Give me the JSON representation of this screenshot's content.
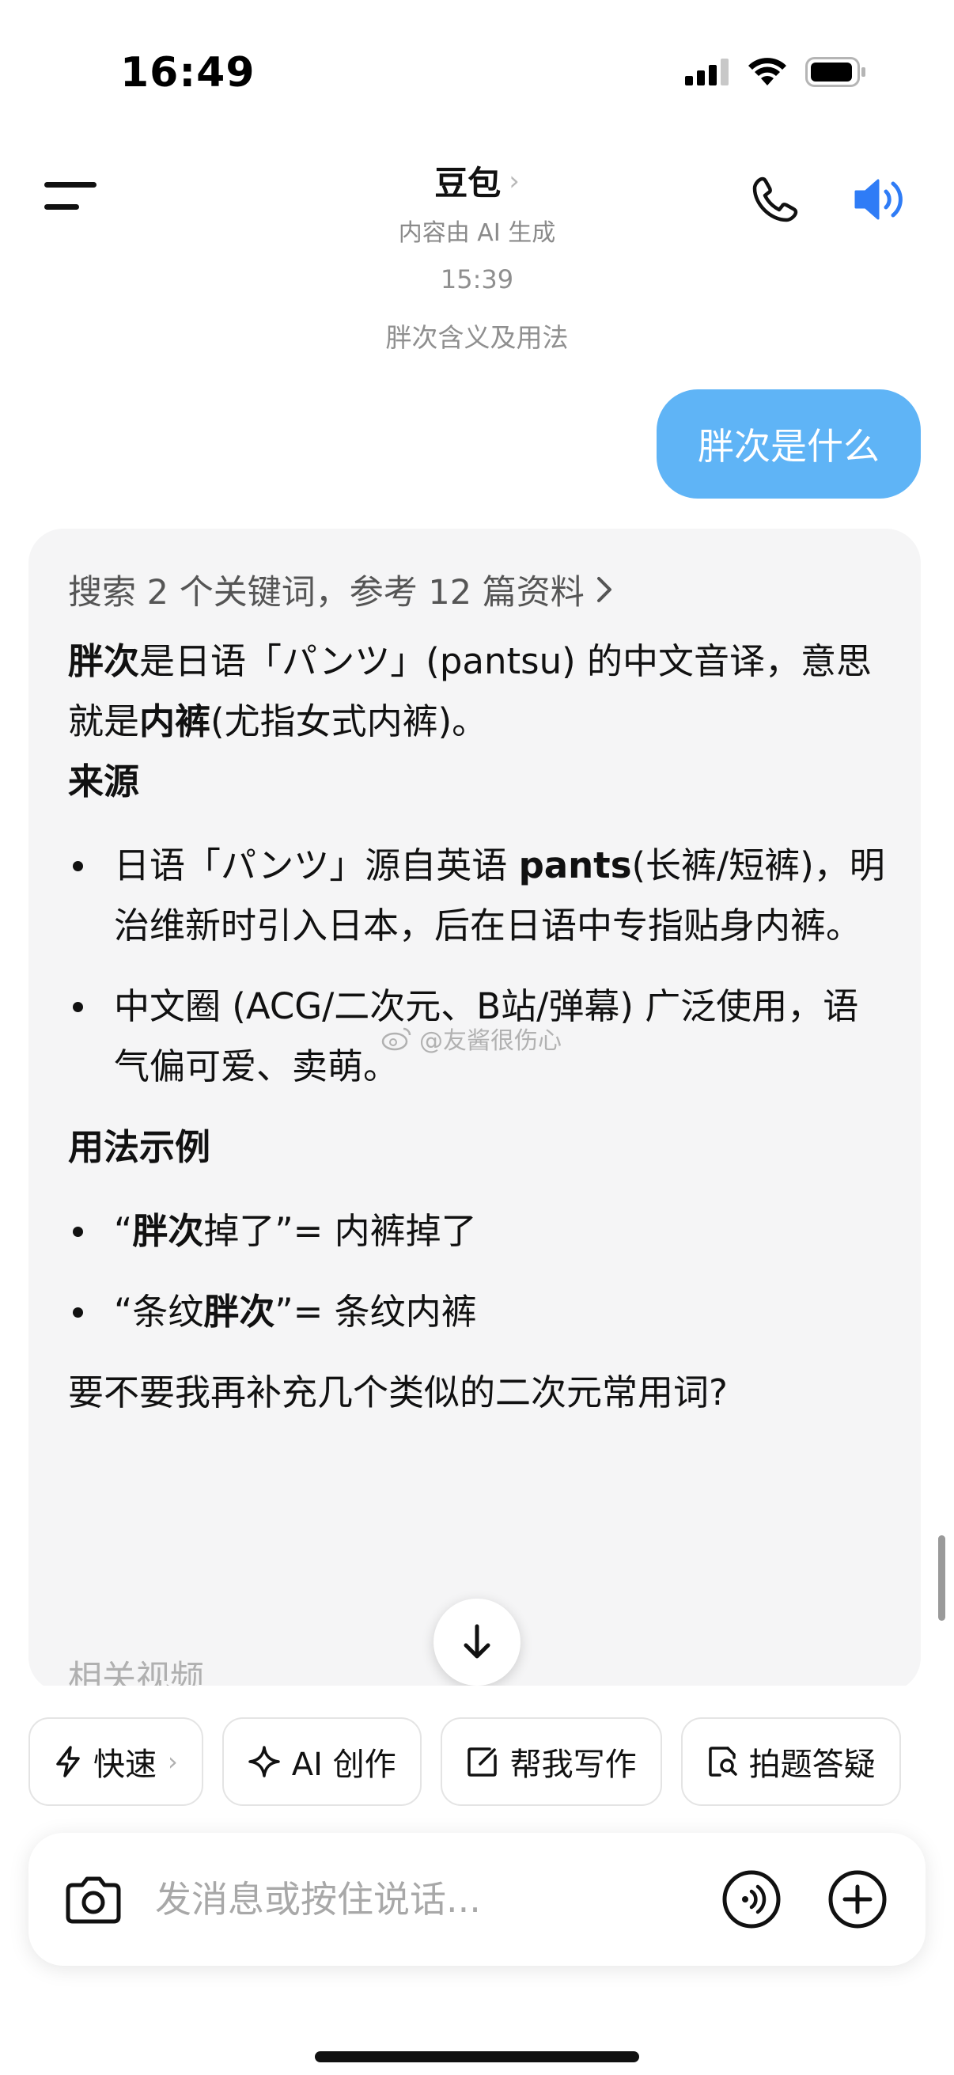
{
  "status_bar": {
    "time": "16:49"
  },
  "header": {
    "title": "豆包",
    "subtitle": "内容由 AI 生成"
  },
  "conversation": {
    "timestamp": "15:39",
    "topic": "胖次含义及用法",
    "user_message": "胖次是什么"
  },
  "answer": {
    "search_summary": "搜索 2 个关键词，参考 12 篇资料",
    "intro_term": "胖次",
    "intro_rest": "是日语「パンツ」(pantsu) 的中文音译，意思就是",
    "intro_bold": "内裤",
    "intro_end": "(尤指女式内裤)。",
    "source_title": "来源",
    "source_b1_pre": "日语「パンツ」源自英语 ",
    "source_b1_bold": "pants",
    "source_b1_post": "(长裤/短裤)，明治维新时引入日本，后在日语中专指贴身内裤。",
    "source_b2": "中文圈 (ACG/二次元、B站/弹幕) 广泛使用，语气偏可爱、卖萌。",
    "usage_title": "用法示例",
    "usage_b1_open": "“",
    "usage_b1_bold": "胖次",
    "usage_b1_post": "掉了”= 内裤掉了",
    "usage_b2_pre": "“条纹",
    "usage_b2_bold": "胖次",
    "usage_b2_post": "”= 条纹内裤",
    "closing": "要不要我再补充几个类似的二次元常用词?",
    "related_title": "相关视频"
  },
  "watermark": "@友酱很伤心",
  "quick_actions": {
    "fast": "快速",
    "ai_create": "AI 创作",
    "write": "帮我写作",
    "photo_qa": "拍题答疑"
  },
  "input": {
    "placeholder": "发消息或按住说话..."
  },
  "colors": {
    "accent": "#2f7cf6",
    "user_bubble": "#5fb4f6",
    "card_bg": "#f5f5f6"
  }
}
